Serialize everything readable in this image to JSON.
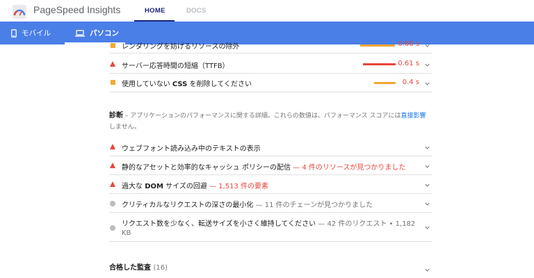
{
  "header": {
    "app_title": "PageSpeed Insights",
    "nav": {
      "home": "HOME",
      "docs": "DOCS"
    }
  },
  "device_tabs": {
    "mobile": "モバイル",
    "desktop": "パソコン"
  },
  "opportunities": [
    {
      "label": "レンダリングを妨げるリソースの除外",
      "value": "0.66 s",
      "status": "average",
      "bar_fraction": 0.5,
      "bar_color": "#f3a732"
    },
    {
      "label": "サーバー応答時間の短縮（TTFB）",
      "value": "0.61 s",
      "status": "fail",
      "bar_fraction": 0.47,
      "bar_color": "#e8453c"
    },
    {
      "label_pre": "使用していない ",
      "label_bold": "CSS",
      "label_post": " を削除してください",
      "value": "0.4 s",
      "status": "average",
      "bar_fraction": 0.31,
      "bar_color": "#f3a732"
    }
  ],
  "diagnostics": {
    "title": "診断",
    "description": " – アプリケーションのパフォーマンスに関する詳細。これらの数値は、パフォーマンス スコアには",
    "link_text": "直接影響",
    "description_end": "しません。",
    "items": [
      {
        "label": "ウェブフォント読み込み中のテキストの表示",
        "sub": "",
        "status": "fail"
      },
      {
        "label": "静的なアセットと効率的なキャッシュ ポリシーの配信",
        "sub": "— 4 件のリソースが見つかりました",
        "status": "fail"
      },
      {
        "label_pre": "過大な ",
        "label_bold": "DOM",
        "label_post": " サイズの回避",
        "sub": "— 1,513 件の要素",
        "status": "fail"
      },
      {
        "label": "クリティカルなリクエストの深さの最小化",
        "sub": "— 11 件のチェーンが見つかりました",
        "status": "info"
      },
      {
        "label": "リクエスト数を少なく、転送サイズを小さく維持してください",
        "sub": "— 42 件のリクエスト • 1,182",
        "sub_line2": "KB",
        "status": "info"
      }
    ]
  },
  "passed": {
    "title": "合格した監査",
    "count": "(16)"
  },
  "colors": {
    "accent": "#4a7fe8",
    "fail": "#e8453c",
    "average": "#f3a732",
    "info": "#bdbdbd",
    "nav_active": "#1a237e"
  }
}
